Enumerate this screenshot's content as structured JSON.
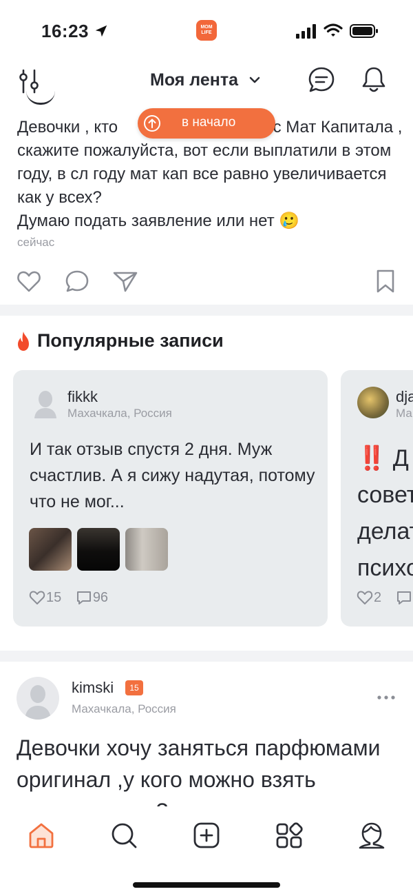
{
  "status_bar": {
    "time": "16:23",
    "app_badge": "MOM LIFE"
  },
  "header": {
    "title": "Моя лента"
  },
  "to_top_button": {
    "label": "в начало"
  },
  "post1": {
    "text": "Девочки , кто получил выплату с Мат Капитала , скажите пожалуйста, вот если выплатили в этом году, в сл году мат кап все равно увеличивается как у всех? Думаю подать заявление или нет 🥲",
    "text_visible_start": "Девочки , кто ",
    "text_visible_rest": "ату с Мат Капитала , скажите пожалуйста, вот если выплатили в этом году, в сл году мат кап все равно увеличивается как у всех?",
    "text_line_last": "Думаю подать заявление или нет",
    "emoji": "🥲",
    "time": "сейчас"
  },
  "popular": {
    "title": "Популярные записи",
    "cards": [
      {
        "author": "fikkk",
        "location": "Махачкала, Россия",
        "text": "И так отзыв спустя 2 дня. Муж счастлив.   А я сижу надутая, потому что не мог...",
        "likes": "15",
        "comments": "96"
      },
      {
        "author": "dja",
        "location": "Ма",
        "bang": "‼️",
        "text_line1": " Д",
        "text_line2": "совет",
        "text_line3": "делат",
        "text_line4": "психо",
        "likes": "2"
      }
    ]
  },
  "post3": {
    "author": "kimski",
    "badge": "15",
    "location": "Махачкала, Россия",
    "text": "Девочки хочу заняться парфюмами оригинал ,у кого можно взять поставщиков ?"
  },
  "colors": {
    "accent": "#f2703f",
    "card_bg": "#e9ecee",
    "muted": "#9a9ca3"
  }
}
